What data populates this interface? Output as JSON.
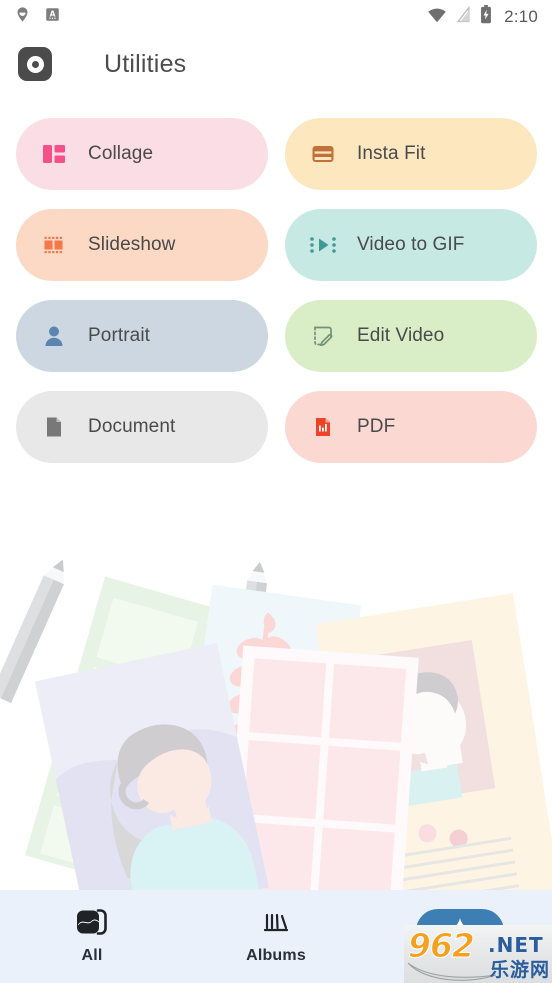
{
  "status_bar": {
    "icons_left": [
      "location-pin-icon",
      "font-size-icon"
    ],
    "icons_right": [
      "wifi-icon",
      "signal-off-icon",
      "battery-charging-icon"
    ],
    "clock": "2:10"
  },
  "app_bar": {
    "icon": "camera-app-icon",
    "title": "Utilities"
  },
  "utilities": [
    {
      "label": "Collage",
      "icon": "collage-icon",
      "bg": "#fbdde6",
      "fg": "#f4508a"
    },
    {
      "label": "Insta Fit",
      "icon": "insta-fit-icon",
      "bg": "#fce7bf",
      "fg": "#c2703a"
    },
    {
      "label": "Slideshow",
      "icon": "slideshow-icon",
      "bg": "#fbd9c4",
      "fg": "#f4784a"
    },
    {
      "label": "Video to GIF",
      "icon": "video-to-gif-icon",
      "bg": "#c7e9e4",
      "fg": "#3f9a96"
    },
    {
      "label": "Portrait",
      "icon": "portrait-icon",
      "bg": "#ccd7e1",
      "fg": "#5b85b0"
    },
    {
      "label": "Edit Video",
      "icon": "edit-video-icon",
      "bg": "#d9eec6",
      "fg": "#73917a"
    },
    {
      "label": "Document",
      "icon": "document-icon",
      "bg": "#e8e8e8",
      "fg": "#787878"
    },
    {
      "label": "PDF",
      "icon": "pdf-icon",
      "bg": "#fbd8d1",
      "fg": "#ef4226"
    }
  ],
  "bottom_nav": {
    "background": "#eaf1fb",
    "items": [
      {
        "label": "All",
        "icon": "photos-icon",
        "active": true,
        "style": "plain"
      },
      {
        "label": "Albums",
        "icon": "albums-icon",
        "active": false,
        "style": "plain"
      },
      {
        "label": "",
        "icon": "sparkle-icon",
        "active": false,
        "style": "pill",
        "pill_color": "#3d7fb5"
      }
    ]
  },
  "watermark": {
    "brand": "962",
    "suffix": ".NET",
    "cn": "乐游网"
  }
}
